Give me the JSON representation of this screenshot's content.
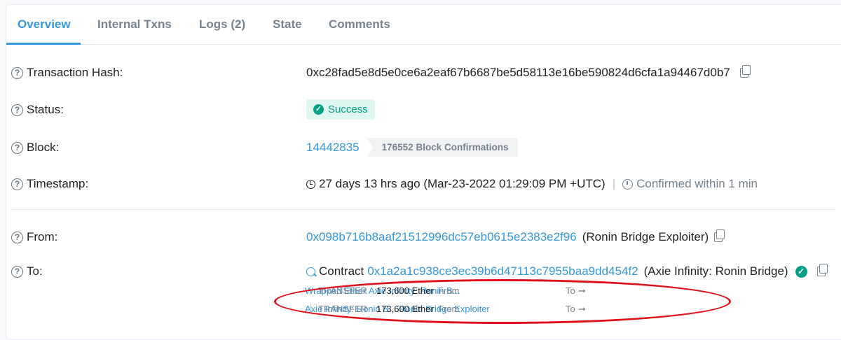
{
  "tabs": [
    {
      "label": "Overview",
      "active": true
    },
    {
      "label": "Internal Txns"
    },
    {
      "label": "Logs (2)"
    },
    {
      "label": "State"
    },
    {
      "label": "Comments"
    }
  ],
  "transaction_hash": {
    "label": "Transaction Hash:",
    "value": "0xc28fad5e8d5e0ce6a2eaf67b6687be5d58113e16be590824d6cfa1a94467d0b7"
  },
  "status": {
    "label": "Status:",
    "value": "Success",
    "color": "#00a186"
  },
  "block": {
    "label": "Block:",
    "number": "14442835",
    "confirmations": "176552 Block Confirmations"
  },
  "timestamp": {
    "label": "Timestamp:",
    "value": "27 days 13 hrs ago (Mar-23-2022 01:29:09 PM +UTC)",
    "separator": "|",
    "confirmed": "Confirmed within 1 min"
  },
  "from": {
    "label": "From:",
    "address": "0x098b716b8aaf21512996dc57eb0615e2383e2f96",
    "name": "(Ronin Bridge Exploiter)"
  },
  "to": {
    "label": "To:",
    "prefix": "Contract",
    "address": "0x1a2a1c938ce3ec39b6d47113c7955baa9dd454f2",
    "name": "(Axie Infinity: Ronin Bridge)"
  },
  "transfers": [
    {
      "branch": "└",
      "label": "TRANSFER",
      "amount": "173,600 Ether",
      "from_label": "From",
      "from": "Wrapped Ether",
      "to_label": "To",
      "arrow": "➞",
      "to": "Axie Infinity: Ronin B..."
    },
    {
      "branch": "└",
      "label": "TRANSFER",
      "amount": "173,600 Ether",
      "from_label": "From",
      "from": "Axie Infinity: Ronin B...",
      "to_label": "To",
      "arrow": "➞",
      "to": "Ronin Bridge Exploiter"
    }
  ],
  "colors": {
    "accent": "#3498db",
    "success": "#00a186",
    "highlight": "#e0101a"
  },
  "help_icon_glyph": "?"
}
